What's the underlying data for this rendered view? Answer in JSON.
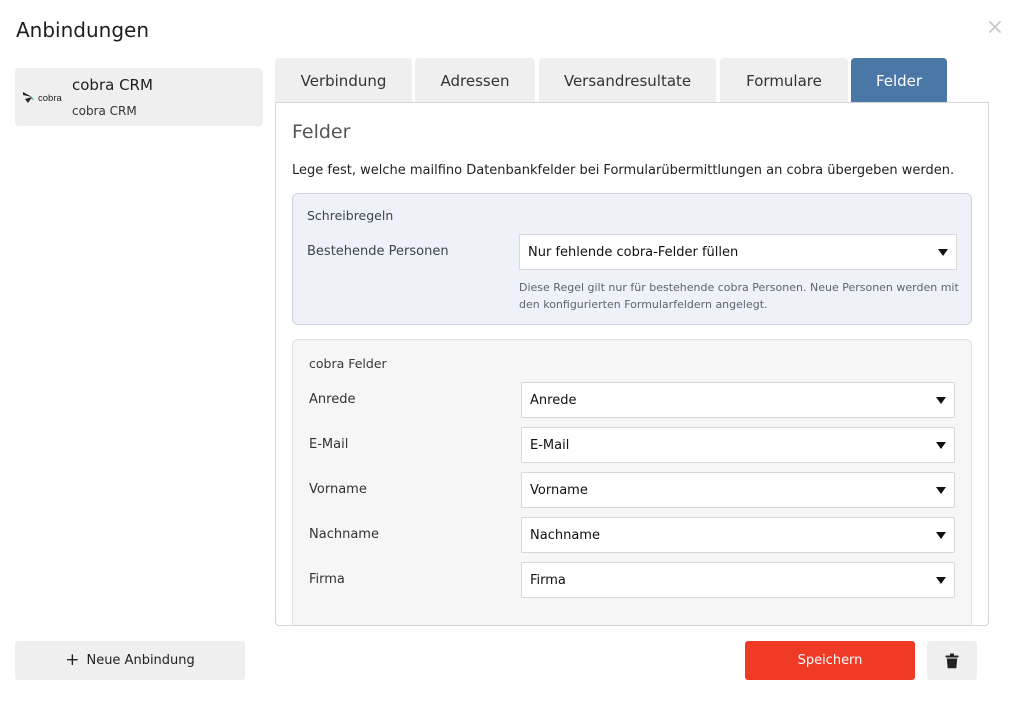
{
  "dialog": {
    "title": "Anbindungen",
    "close_icon": "close-icon"
  },
  "sidebar": {
    "items": [
      {
        "logo_text": "cobra",
        "name": "cobra CRM",
        "sub": "cobra CRM"
      }
    ],
    "new_button_label": "Neue Anbindung"
  },
  "tabs": [
    {
      "label": "Verbindung",
      "active": false
    },
    {
      "label": "Adressen",
      "active": false
    },
    {
      "label": "Versandresultate",
      "active": false
    },
    {
      "label": "Formulare",
      "active": false
    },
    {
      "label": "Felder",
      "active": true
    }
  ],
  "panel": {
    "title": "Felder",
    "description": "Lege fest, welche mailfino Datenbankfelder bei Formularübermittlungen an cobra übergeben werden."
  },
  "rules": {
    "title": "Schreibregeln",
    "label": "Bestehende Personen",
    "value": "Nur fehlende cobra-Felder füllen",
    "hint": "Diese Regel gilt nur für bestehende cobra Personen. Neue Personen werden mit den konfigurierten Formularfeldern angelegt."
  },
  "fields": {
    "title": "cobra Felder",
    "rows": [
      {
        "label": "Anrede",
        "value": "Anrede"
      },
      {
        "label": "E-Mail",
        "value": "E-Mail"
      },
      {
        "label": "Vorname",
        "value": "Vorname"
      },
      {
        "label": "Nachname",
        "value": "Nachname"
      },
      {
        "label": "Firma",
        "value": "Firma"
      }
    ]
  },
  "footer": {
    "save_label": "Speichern",
    "delete_icon": "trash-icon"
  },
  "colors": {
    "accent_tab": "#4b77a6",
    "save_button": "#ef3b26",
    "rules_background": "#eef2f8"
  }
}
